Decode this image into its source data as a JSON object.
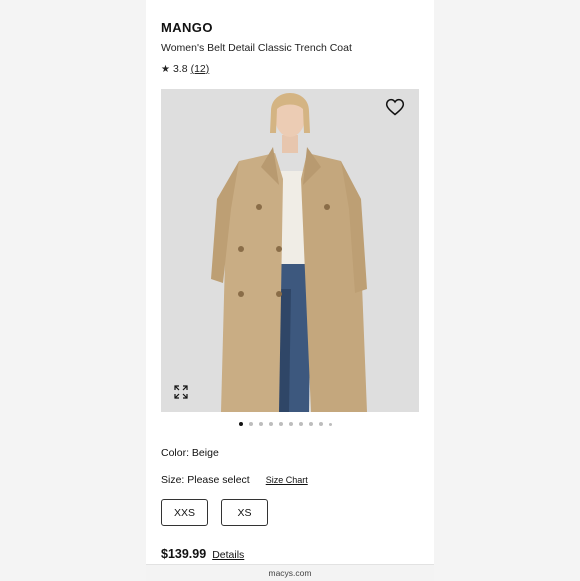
{
  "product": {
    "brand": "MANGO",
    "name": "Women's Belt Detail Classic Trench Coat",
    "rating": "3.8",
    "review_count": "(12)"
  },
  "gallery": {
    "wishlist_icon": "heart-icon",
    "expand_icon": "expand-icon",
    "total_images": 10,
    "active_index": 0
  },
  "options": {
    "color_label": "Color: Beige",
    "size_label": "Size: Please select",
    "size_chart_link": "Size Chart",
    "sizes": [
      "XXS",
      "XS"
    ]
  },
  "pricing": {
    "price": "$139.99",
    "details_link": "Details"
  },
  "browser": {
    "url": "macys.com"
  },
  "colors": {
    "coat": "#c9ad84",
    "background": "#dedede",
    "jeans": "#3d587e"
  }
}
